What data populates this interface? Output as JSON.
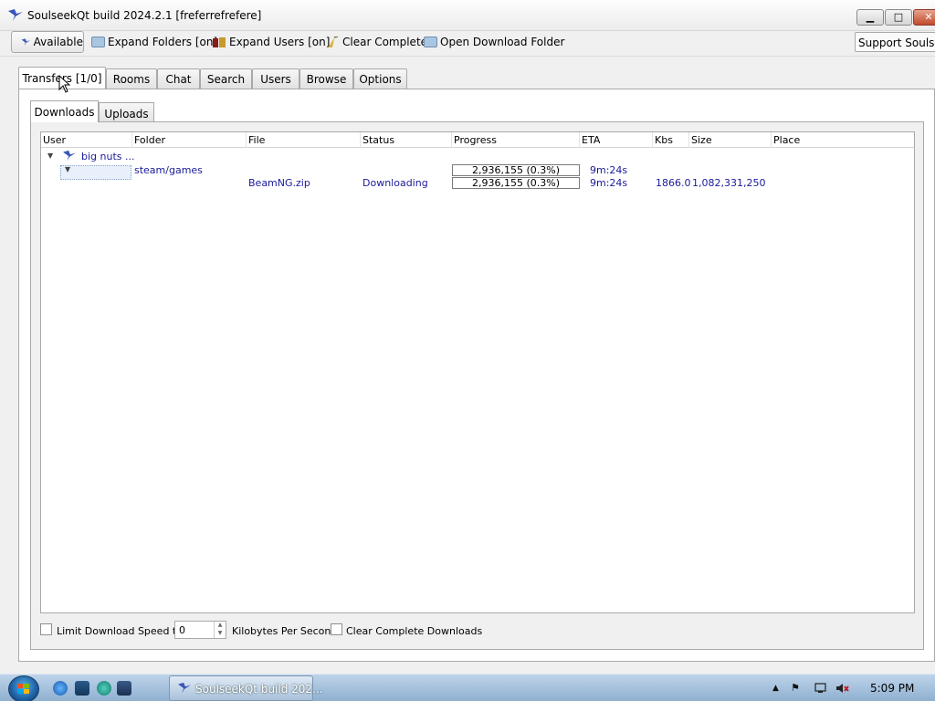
{
  "window": {
    "title": "SoulseekQt build 2024.2.1 [freferrefrefere]"
  },
  "toolbar": {
    "available": "Available",
    "expand_folders": "Expand Folders [on]",
    "expand_users": "Expand Users [on]",
    "clear_complete": "Clear Complete",
    "open_download_folder": "Open Download Folder",
    "support": "Support Soulseek"
  },
  "main_tabs": [
    "Transfers [1/0]",
    "Rooms",
    "Chat",
    "Search",
    "Users",
    "Browse",
    "Options"
  ],
  "sub_tabs": [
    "Downloads",
    "Uploads"
  ],
  "columns": [
    "User",
    "Folder",
    "File",
    "Status",
    "Progress",
    "ETA",
    "Kbs",
    "Size",
    "Place"
  ],
  "tree": {
    "user": "big nuts ...",
    "folder_row": {
      "folder": "steam/games",
      "progress": "2,936,155 (0.3%)",
      "progress_fraction": 0.003,
      "eta": "9m:24s"
    },
    "file_row": {
      "file": "BeamNG.zip",
      "status": "Downloading",
      "progress": "2,936,155 (0.3%)",
      "progress_fraction": 0.003,
      "eta": "9m:24s",
      "kbs": "1866.0",
      "size": "1,082,331,250"
    }
  },
  "bottom": {
    "limit_label": "Limit Download Speed to",
    "speed_value": "0",
    "units_label": "Kilobytes Per Second",
    "clear_complete_label": "Clear Complete Downloads"
  },
  "taskbar": {
    "task_label": "SoulseekQt build 202...",
    "clock": "5:09 PM"
  },
  "colors": {
    "accent_text": "#1a1a9a",
    "taskbar": "#a9c1da"
  }
}
